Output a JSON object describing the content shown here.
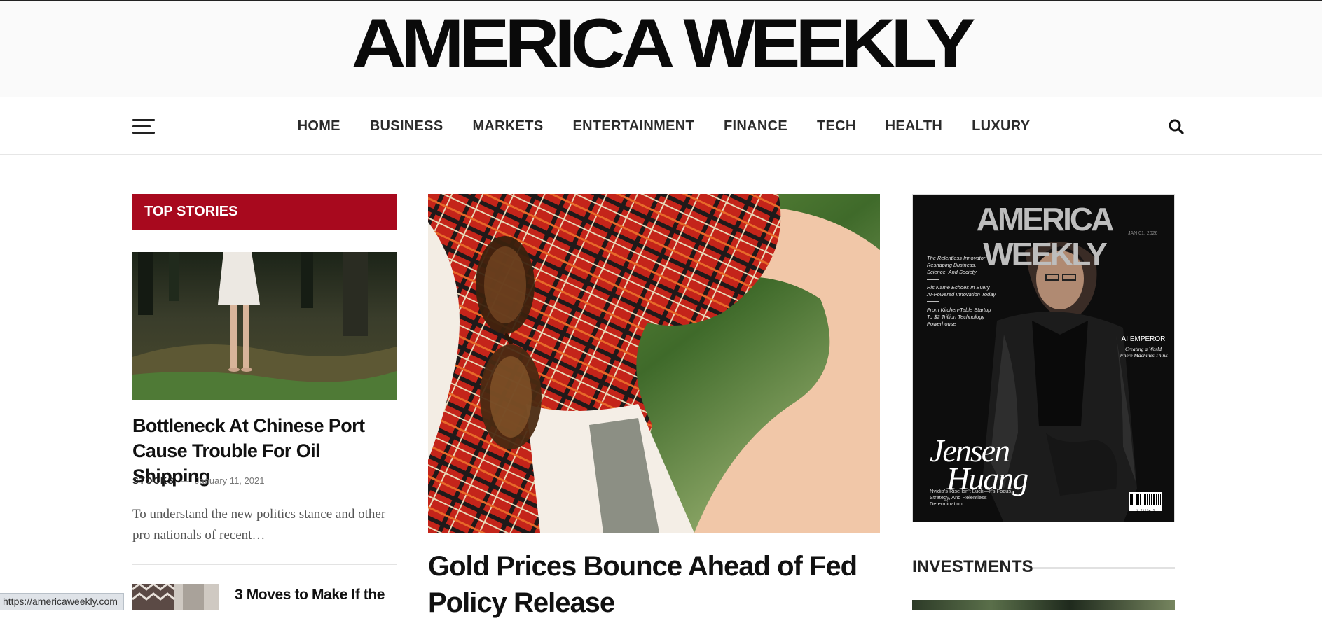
{
  "site": {
    "logo_text": "AMERICA WEEKLY"
  },
  "nav": {
    "items": [
      "HOME",
      "BUSINESS",
      "MARKETS",
      "ENTERTAINMENT",
      "FINANCE",
      "TECH",
      "HEALTH",
      "LUXURY"
    ]
  },
  "top_stories": {
    "heading": "TOP STORIES",
    "lead": {
      "title": "Bottleneck At Chinese Port Cause Trouble For Oil Shipping",
      "category": "STOCKS",
      "separator": "—",
      "date": "January 11, 2021",
      "excerpt": "To understand the new politics stance and other pro nationals of recent…"
    },
    "second": {
      "title": "3 Moves to Make If the"
    }
  },
  "featured": {
    "title": "Gold Prices Bounce Ahead of Fed Policy Release"
  },
  "magazine_cover": {
    "logo": "AMERICA WEEKLY",
    "date": "JAN 01, 2026",
    "cover_lines": [
      "The Relentless Innovator Reshaping Business, Science, And Society",
      "His Name Echoes In Every AI-Powered Innovation Today",
      "From Kitchen-Table Startup To $2 Trillion Technology Powerhouse"
    ],
    "headline": "AI EMPEROR",
    "headline_sub": "Creating a World Where Machines Think",
    "name_line1": "Jensen",
    "name_line2": "Huang",
    "tagline": "Nvidia's Rise Isn't Luck—It's Focus, Strategy, And Relentless Determination",
    "barcode_number": "1 71234 5"
  },
  "sidebar": {
    "section_heading": "INVESTMENTS"
  },
  "status_bar": {
    "url": "https://americaweekly.com"
  }
}
